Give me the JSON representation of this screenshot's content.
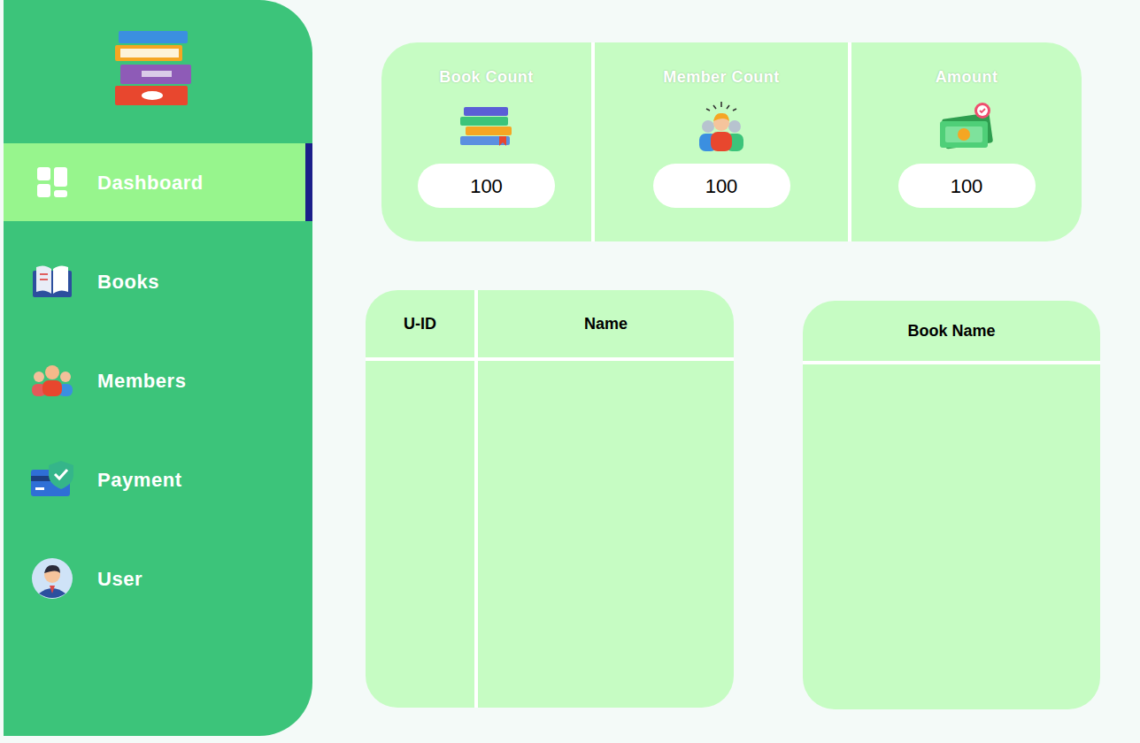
{
  "sidebar": {
    "items": [
      {
        "label": "Dashboard",
        "selected": true,
        "kind": "dashboard"
      },
      {
        "label": "Books",
        "selected": false,
        "kind": "books"
      },
      {
        "label": "Members",
        "selected": false,
        "kind": "members"
      },
      {
        "label": "Payment",
        "selected": false,
        "kind": "payment"
      },
      {
        "label": "User",
        "selected": false,
        "kind": "user"
      }
    ]
  },
  "stats": [
    {
      "title": "Book Count",
      "value": "100",
      "kind": "books"
    },
    {
      "title": "Member Count",
      "value": "100",
      "kind": "members"
    },
    {
      "title": "Amount",
      "value": "100",
      "kind": "amount"
    }
  ],
  "members_table": {
    "columns": [
      "U-ID",
      "Name"
    ],
    "rows": []
  },
  "books_table": {
    "columns": [
      "Book Name"
    ],
    "rows": []
  }
}
